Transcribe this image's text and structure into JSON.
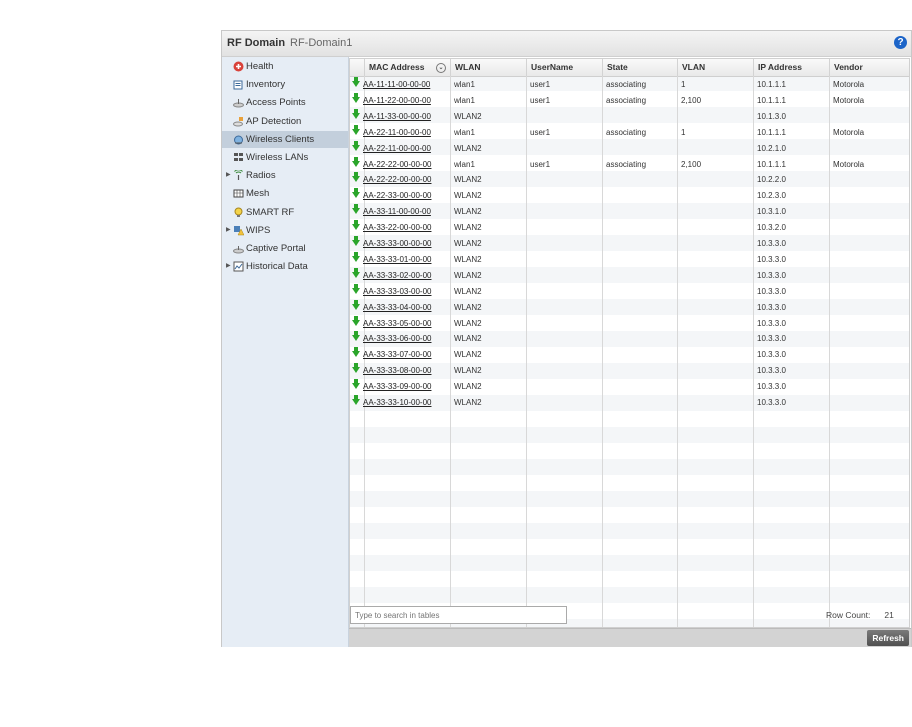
{
  "header": {
    "title": "RF Domain",
    "subtitle": "RF-Domain1",
    "help": "?"
  },
  "sidebar": {
    "items": [
      {
        "label": "Health",
        "icon": "health-icon",
        "expandable": false,
        "selected": false
      },
      {
        "label": "Inventory",
        "icon": "inventory-icon",
        "expandable": false,
        "selected": false
      },
      {
        "label": "Access Points",
        "icon": "access-point-icon",
        "expandable": false,
        "selected": false
      },
      {
        "label": "AP Detection",
        "icon": "ap-detection-icon",
        "expandable": false,
        "selected": false
      },
      {
        "label": "Wireless Clients",
        "icon": "wireless-clients-icon",
        "expandable": false,
        "selected": true
      },
      {
        "label": "Wireless LANs",
        "icon": "wireless-lans-icon",
        "expandable": false,
        "selected": false
      },
      {
        "label": "Radios",
        "icon": "radios-icon",
        "expandable": true,
        "selected": false
      },
      {
        "label": "Mesh",
        "icon": "mesh-icon",
        "expandable": false,
        "selected": false
      },
      {
        "label": "SMART RF",
        "icon": "smart-rf-icon",
        "expandable": false,
        "selected": false
      },
      {
        "label": "WIPS",
        "icon": "wips-icon",
        "expandable": true,
        "selected": false
      },
      {
        "label": "Captive Portal",
        "icon": "captive-portal-icon",
        "expandable": false,
        "selected": false
      },
      {
        "label": "Historical Data",
        "icon": "historical-data-icon",
        "expandable": true,
        "selected": false
      }
    ]
  },
  "table": {
    "columns": [
      "MAC Address",
      "WLAN",
      "UserName",
      "State",
      "VLAN",
      "IP Address",
      "Vendor"
    ],
    "rows": [
      [
        "AA-11-11-00-00-00",
        "wlan1",
        "user1",
        "associating",
        "1",
        "10.1.1.1",
        "Motorola"
      ],
      [
        "AA-11-22-00-00-00",
        "wlan1",
        "user1",
        "associating",
        "2,100",
        "10.1.1.1",
        "Motorola"
      ],
      [
        "AA-11-33-00-00-00",
        "WLAN2",
        "",
        "",
        "",
        "10.1.3.0",
        ""
      ],
      [
        "AA-22-11-00-00-00",
        "wlan1",
        "user1",
        "associating",
        "1",
        "10.1.1.1",
        "Motorola"
      ],
      [
        "AA-22-11-00-00-00",
        "WLAN2",
        "",
        "",
        "",
        "10.2.1.0",
        ""
      ],
      [
        "AA-22-22-00-00-00",
        "wlan1",
        "user1",
        "associating",
        "2,100",
        "10.1.1.1",
        "Motorola"
      ],
      [
        "AA-22-22-00-00-00",
        "WLAN2",
        "",
        "",
        "",
        "10.2.2.0",
        ""
      ],
      [
        "AA-22-33-00-00-00",
        "WLAN2",
        "",
        "",
        "",
        "10.2.3.0",
        ""
      ],
      [
        "AA-33-11-00-00-00",
        "WLAN2",
        "",
        "",
        "",
        "10.3.1.0",
        ""
      ],
      [
        "AA-33-22-00-00-00",
        "WLAN2",
        "",
        "",
        "",
        "10.3.2.0",
        ""
      ],
      [
        "AA-33-33-00-00-00",
        "WLAN2",
        "",
        "",
        "",
        "10.3.3.0",
        ""
      ],
      [
        "AA-33-33-01-00-00",
        "WLAN2",
        "",
        "",
        "",
        "10.3.3.0",
        ""
      ],
      [
        "AA-33-33-02-00-00",
        "WLAN2",
        "",
        "",
        "",
        "10.3.3.0",
        ""
      ],
      [
        "AA-33-33-03-00-00",
        "WLAN2",
        "",
        "",
        "",
        "10.3.3.0",
        ""
      ],
      [
        "AA-33-33-04-00-00",
        "WLAN2",
        "",
        "",
        "",
        "10.3.3.0",
        ""
      ],
      [
        "AA-33-33-05-00-00",
        "WLAN2",
        "",
        "",
        "",
        "10.3.3.0",
        ""
      ],
      [
        "AA-33-33-06-00-00",
        "WLAN2",
        "",
        "",
        "",
        "10.3.3.0",
        ""
      ],
      [
        "AA-33-33-07-00-00",
        "WLAN2",
        "",
        "",
        "",
        "10.3.3.0",
        ""
      ],
      [
        "AA-33-33-08-00-00",
        "WLAN2",
        "",
        "",
        "",
        "10.3.3.0",
        ""
      ],
      [
        "AA-33-33-09-00-00",
        "WLAN2",
        "",
        "",
        "",
        "10.3.3.0",
        ""
      ],
      [
        "AA-33-33-10-00-00",
        "WLAN2",
        "",
        "",
        "",
        "10.3.3.0",
        ""
      ]
    ]
  },
  "search": {
    "placeholder": "Type to search in tables"
  },
  "footer": {
    "row_count_label": "Row Count:",
    "row_count": "21",
    "refresh_label": "Refresh"
  },
  "colors": {
    "accent": "#1c64c8",
    "selected_nav": "#c3cfdc",
    "sidebar_bg": "#e6edf5",
    "status_icon": "#2aa52a"
  }
}
